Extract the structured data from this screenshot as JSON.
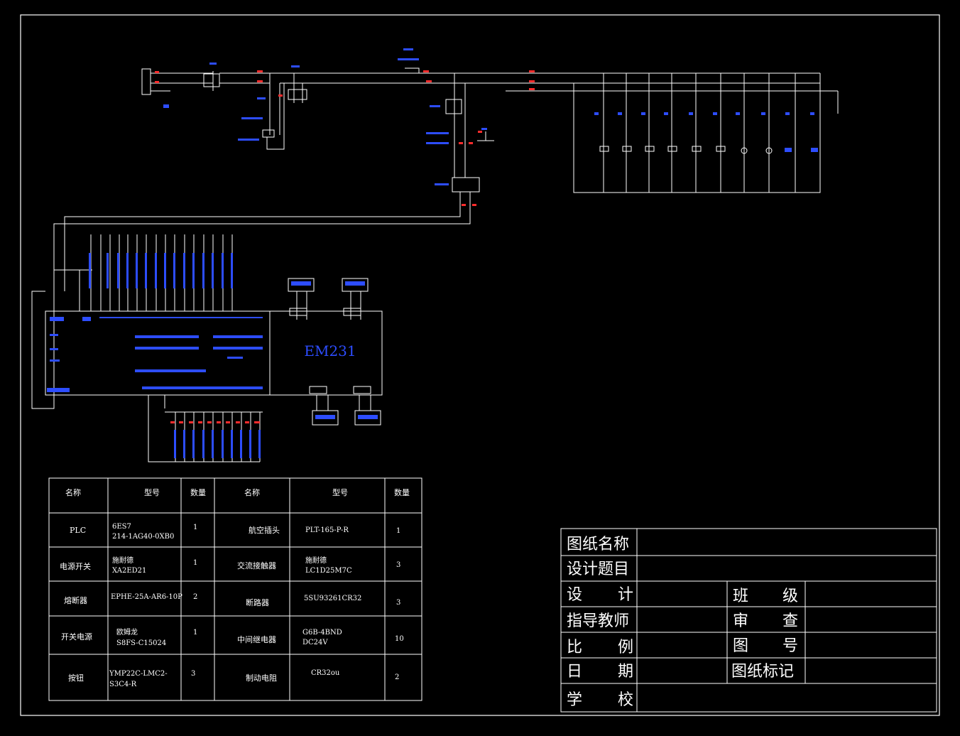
{
  "diagram": {
    "module_label": "EM231"
  },
  "parts_table": {
    "headers": [
      "名称",
      "型号",
      "数量",
      "名称",
      "型号",
      "数量"
    ],
    "rows": [
      {
        "name1": "PLC",
        "model1": [
          "6ES7",
          "214-1AG40-0XB0"
        ],
        "qty1": "1",
        "name2": "航空插头",
        "model2": [
          "PLT-165-P-R"
        ],
        "qty2": "1"
      },
      {
        "name1": "电源开关",
        "model1": [
          "施耐德",
          "XA2ED21"
        ],
        "qty1": "1",
        "name2": "交流接触器",
        "model2": [
          "施耐德",
          "LC1D25M7C"
        ],
        "qty2": "3"
      },
      {
        "name1": "熔断器",
        "model1": [
          "EPHE-25A-AR6-10P"
        ],
        "qty1": "2",
        "name2": "断路器",
        "model2": [
          "5SU93261CR32"
        ],
        "qty2": "3"
      },
      {
        "name1": "开关电源",
        "model1": [
          "欧姆龙",
          "S8FS-C15024"
        ],
        "qty1": "1",
        "name2": "中间继电器",
        "model2": [
          "G6B-4BND",
          "DC24V"
        ],
        "qty2": "10"
      },
      {
        "name1": "按钮",
        "model1": [
          "YMP22C-LMC2-",
          "S3C4-R"
        ],
        "qty1": "3",
        "name2": "制动电阻",
        "model2": [
          "CR32ou"
        ],
        "qty2": "2"
      }
    ]
  },
  "title_block": {
    "drawing_name_label": "图纸名称",
    "design_topic_label": "设计题目",
    "design_label": "设　计",
    "class_label": "班　级",
    "instructor_label": "指导教师",
    "review_label": "审　查",
    "scale_label": "比　例",
    "drawing_no_label": "图　号",
    "date_label": "日　期",
    "drawing_mark_label": "图纸标记",
    "school_label": "学　校"
  }
}
